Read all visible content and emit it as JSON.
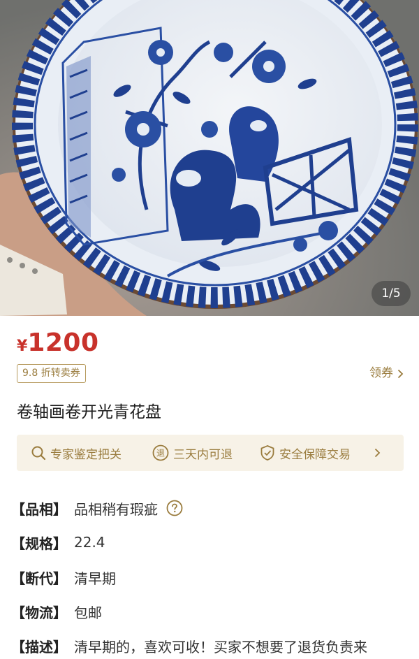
{
  "gallery": {
    "counter": "1/5",
    "image_subject": "blue-and-white-plate-photo"
  },
  "price": {
    "currency": "¥",
    "amount": "1200",
    "color": "#c8322b"
  },
  "coupon": {
    "label": "9.8 折转卖券",
    "claim_label": "领券"
  },
  "product": {
    "title": "卷轴画卷开光青花盘"
  },
  "guarantees": {
    "items": [
      {
        "label": "专家鉴定把关",
        "icon": "magnifier-icon"
      },
      {
        "label": "三天内可退",
        "icon": "return-badge-icon",
        "icon_text": "退"
      },
      {
        "label": "安全保障交易",
        "icon": "shield-check-icon"
      }
    ],
    "accent": "#9a7c3e",
    "background": "#f7f2e7"
  },
  "attributes": [
    {
      "key": "【品相】",
      "value": "品相稍有瑕疵",
      "has_help": true
    },
    {
      "key": "【规格】",
      "value": "22.4"
    },
    {
      "key": "【断代】",
      "value": "清早期"
    },
    {
      "key": "【物流】",
      "value": "包邮"
    },
    {
      "key": "【描述】",
      "value": "清早期的，喜欢可收！买家不想要了退货负责来"
    }
  ]
}
